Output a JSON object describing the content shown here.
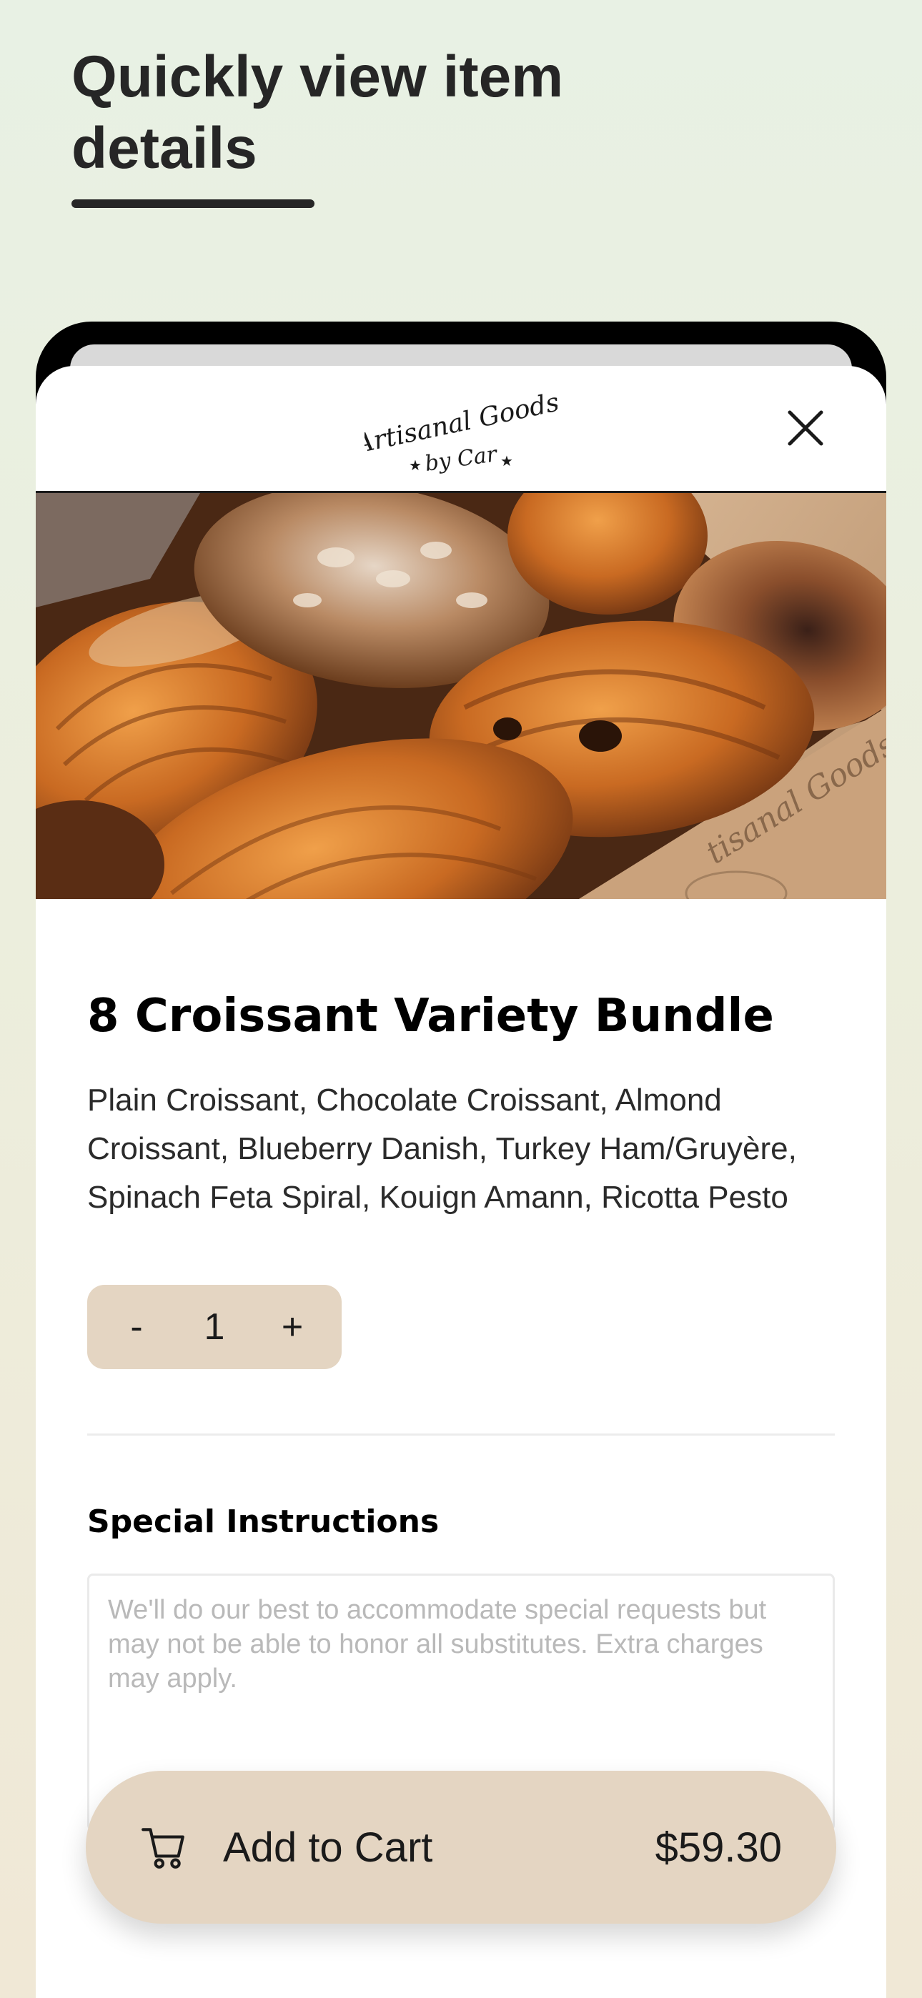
{
  "promo": {
    "headline": "Quickly view item details"
  },
  "header": {
    "brand_line1": "Artisanal Goods",
    "brand_line2": "by Car",
    "close_icon": "close-icon"
  },
  "product": {
    "image_icon": "pastry-photo",
    "title": "8 Croissant Variety Bundle",
    "description": "Plain Croissant, Chocolate Croissant, Almond Croissant, Blueberry Danish, Turkey Ham/Gruyère, Spinach Feta Spiral, Kouign Amann, Ricotta Pesto"
  },
  "quantity": {
    "decrement_label": "-",
    "value": "1",
    "increment_label": "+"
  },
  "special_instructions": {
    "label": "Special Instructions",
    "value": "",
    "placeholder": "We'll do our best to accommodate special requests but may not be able to honor all substitutes. Extra charges may apply."
  },
  "cart": {
    "icon": "cart-icon",
    "label": "Add to Cart",
    "price": "$59.30"
  },
  "colors": {
    "accent_beige": "#e4d5c2",
    "text_dark": "#1a1a1a",
    "placeholder_gray": "#b9b9b9",
    "background_green": "#e8f1e4",
    "background_cream": "#f0e8d6"
  }
}
